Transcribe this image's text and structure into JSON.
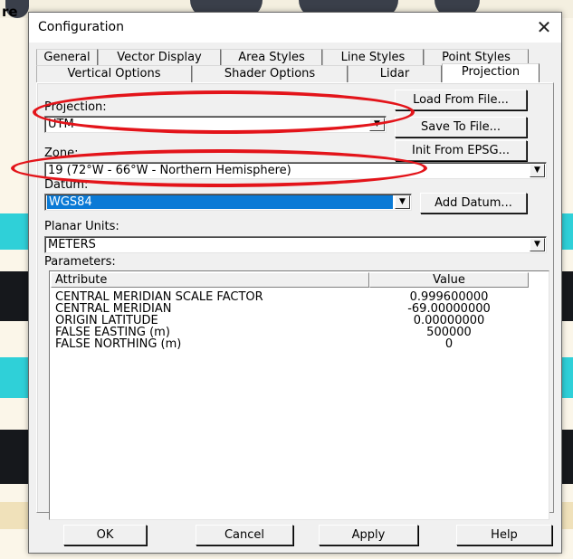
{
  "background": {
    "left_label": "re"
  },
  "dialog": {
    "title": "Configuration",
    "close_glyph": "✕"
  },
  "tabs": {
    "row1": [
      "General",
      "Vector Display",
      "Area Styles",
      "Line Styles",
      "Point Styles"
    ],
    "row2": [
      "Vertical Options",
      "Shader Options",
      "Lidar",
      "Projection"
    ],
    "active": "Projection"
  },
  "projection": {
    "label": "Projection:",
    "value": "UTM"
  },
  "zone": {
    "label": "Zone:",
    "value": "19 (72°W - 66°W - Northern Hemisphere)"
  },
  "datum": {
    "label": "Datum:",
    "value": "WGS84"
  },
  "planar_units": {
    "label": "Planar Units:",
    "value": "METERS"
  },
  "parameters": {
    "label": "Parameters:",
    "columns": [
      "Attribute",
      "Value"
    ],
    "rows": [
      {
        "attribute": "CENTRAL MERIDIAN SCALE FACTOR",
        "value": "0.999600000"
      },
      {
        "attribute": "CENTRAL MERIDIAN",
        "value": "-69.00000000"
      },
      {
        "attribute": "ORIGIN LATITUDE",
        "value": "0.00000000"
      },
      {
        "attribute": "FALSE EASTING (m)",
        "value": "500000"
      },
      {
        "attribute": "FALSE NORTHING (m)",
        "value": "0"
      }
    ]
  },
  "side_buttons": {
    "load": "Load From File...",
    "save": "Save To File...",
    "init": "Init From EPSG...",
    "add_datum": "Add Datum..."
  },
  "footer": {
    "ok": "OK",
    "cancel": "Cancel",
    "apply": "Apply",
    "help": "Help"
  },
  "colors": {
    "annotation": "#e3141a",
    "selection": "#0a7ad6"
  },
  "icons": {
    "dropdown": "chevron-down-icon",
    "close": "close-icon"
  }
}
